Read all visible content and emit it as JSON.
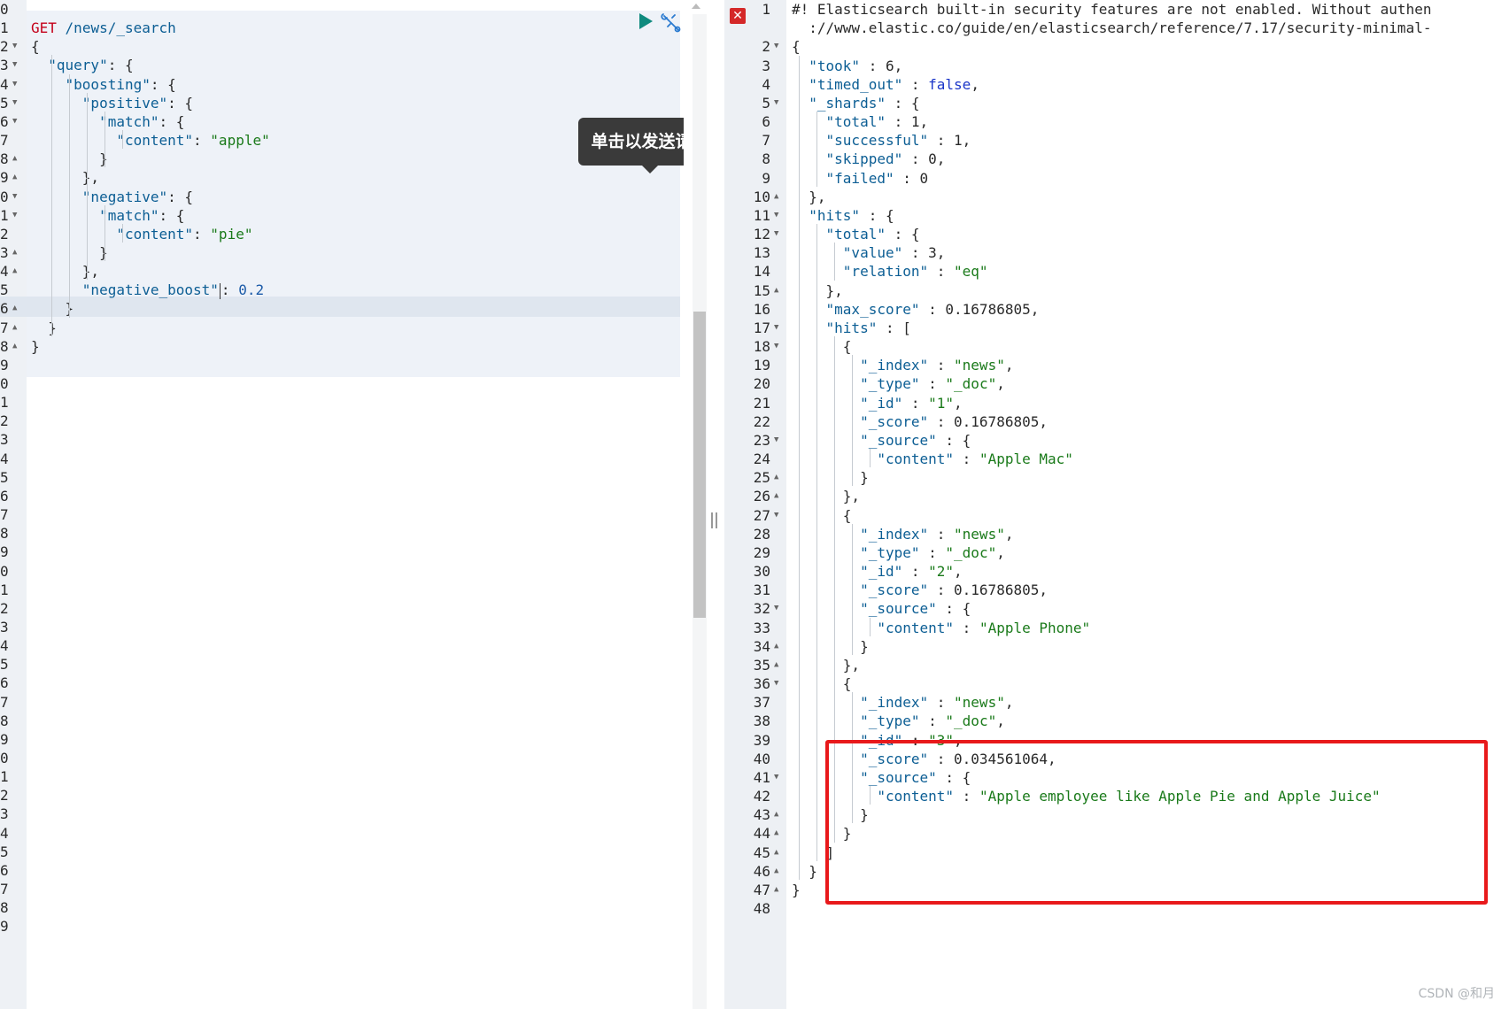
{
  "request": {
    "lines": [
      {
        "n": "0",
        "f": "",
        "t": ""
      },
      {
        "n": "1",
        "f": "",
        "t": [
          [
            "m",
            "GET"
          ],
          [
            "p",
            " "
          ],
          [
            "k",
            "/news/_search"
          ]
        ]
      },
      {
        "n": "2",
        "f": "d",
        "t": [
          [
            "p",
            "{"
          ]
        ]
      },
      {
        "n": "3",
        "f": "d",
        "t": [
          [
            "p",
            "  "
          ],
          [
            "k",
            "\"query\""
          ],
          [
            "p",
            ": {"
          ]
        ]
      },
      {
        "n": "4",
        "f": "d",
        "t": [
          [
            "p",
            "    "
          ],
          [
            "k",
            "\"boosting\""
          ],
          [
            "p",
            ": {"
          ]
        ]
      },
      {
        "n": "5",
        "f": "d",
        "t": [
          [
            "p",
            "      "
          ],
          [
            "k",
            "\"positive\""
          ],
          [
            "p",
            ": {"
          ]
        ]
      },
      {
        "n": "6",
        "f": "d",
        "t": [
          [
            "p",
            "        "
          ],
          [
            "k",
            "\"match\""
          ],
          [
            "p",
            ": {"
          ]
        ]
      },
      {
        "n": "7",
        "f": "",
        "t": [
          [
            "p",
            "          "
          ],
          [
            "k",
            "\"content\""
          ],
          [
            "p",
            ": "
          ],
          [
            "s",
            "\"apple\""
          ]
        ]
      },
      {
        "n": "8",
        "f": "u",
        "t": [
          [
            "p",
            "        }"
          ]
        ]
      },
      {
        "n": "9",
        "f": "u",
        "t": [
          [
            "p",
            "      },"
          ]
        ]
      },
      {
        "n": "0",
        "f": "d",
        "t": [
          [
            "p",
            "      "
          ],
          [
            "k",
            "\"negative\""
          ],
          [
            "p",
            ": {"
          ]
        ]
      },
      {
        "n": "1",
        "f": "d",
        "t": [
          [
            "p",
            "        "
          ],
          [
            "k",
            "\"match\""
          ],
          [
            "p",
            ": {"
          ]
        ]
      },
      {
        "n": "2",
        "f": "",
        "t": [
          [
            "p",
            "          "
          ],
          [
            "k",
            "\"content\""
          ],
          [
            "p",
            ": "
          ],
          [
            "s",
            "\"pie\""
          ]
        ]
      },
      {
        "n": "3",
        "f": "u",
        "t": [
          [
            "p",
            "        }"
          ]
        ]
      },
      {
        "n": "4",
        "f": "u",
        "t": [
          [
            "p",
            "      },"
          ]
        ]
      },
      {
        "n": "5",
        "f": "",
        "t": [
          [
            "p",
            "      "
          ],
          [
            "k",
            "\"negative_boost\""
          ],
          [
            "c",
            ""
          ],
          [
            "p",
            ": "
          ],
          [
            "n",
            "0.2"
          ]
        ]
      },
      {
        "n": "6",
        "f": "u",
        "t": [
          [
            "p",
            "    }"
          ]
        ]
      },
      {
        "n": "7",
        "f": "u",
        "t": [
          [
            "p",
            "  }"
          ]
        ]
      },
      {
        "n": "8",
        "f": "u",
        "t": [
          [
            "p",
            "}"
          ]
        ]
      },
      {
        "n": "9"
      },
      {
        "n": "0"
      },
      {
        "n": "1"
      },
      {
        "n": "2"
      },
      {
        "n": "3"
      },
      {
        "n": "4"
      },
      {
        "n": "5"
      },
      {
        "n": "6"
      },
      {
        "n": "7"
      },
      {
        "n": "8"
      },
      {
        "n": "9"
      },
      {
        "n": "0"
      },
      {
        "n": "1"
      },
      {
        "n": "2"
      },
      {
        "n": "3"
      },
      {
        "n": "4"
      },
      {
        "n": "5"
      },
      {
        "n": "6"
      },
      {
        "n": "7"
      },
      {
        "n": "8"
      },
      {
        "n": "9"
      },
      {
        "n": "0"
      },
      {
        "n": "1"
      },
      {
        "n": "2"
      },
      {
        "n": "3"
      },
      {
        "n": "4"
      },
      {
        "n": "5"
      },
      {
        "n": "6"
      },
      {
        "n": "7"
      },
      {
        "n": "8"
      },
      {
        "n": "9"
      }
    ]
  },
  "tooltip": {
    "label": "单击以发送请求"
  },
  "icons": {
    "run": "play-icon",
    "settings": "wrench-icon",
    "error": "error-x-icon"
  },
  "colors": {
    "highlight": "#e8191b",
    "key": "#0c5e94",
    "string": "#1a7a1a",
    "method": "#c4001a"
  },
  "response": {
    "lines": [
      {
        "n": "1",
        "f": "",
        "t": [
          [
            "p",
            "#! Elasticsearch built-in security features are not enabled. Without authen"
          ]
        ]
      },
      {
        "n": "",
        "f": "",
        "t": [
          [
            "p",
            "  ://www.elastic.co/guide/en/elasticsearch/reference/7.17/security-minimal-"
          ]
        ]
      },
      {
        "n": "2",
        "f": "d",
        "t": [
          [
            "p",
            "{"
          ]
        ]
      },
      {
        "n": "3",
        "f": "",
        "t": [
          [
            "p",
            "  "
          ],
          [
            "k",
            "\"took\""
          ],
          [
            "p",
            " : 6,"
          ]
        ]
      },
      {
        "n": "4",
        "f": "",
        "t": [
          [
            "p",
            "  "
          ],
          [
            "k",
            "\"timed_out\""
          ],
          [
            "p",
            " : "
          ],
          [
            "b",
            "false"
          ],
          [
            "p",
            ","
          ]
        ]
      },
      {
        "n": "5",
        "f": "d",
        "t": [
          [
            "p",
            "  "
          ],
          [
            "k",
            "\"_shards\""
          ],
          [
            "p",
            " : {"
          ]
        ]
      },
      {
        "n": "6",
        "f": "",
        "t": [
          [
            "p",
            "    "
          ],
          [
            "k",
            "\"total\""
          ],
          [
            "p",
            " : 1,"
          ]
        ]
      },
      {
        "n": "7",
        "f": "",
        "t": [
          [
            "p",
            "    "
          ],
          [
            "k",
            "\"successful\""
          ],
          [
            "p",
            " : 1,"
          ]
        ]
      },
      {
        "n": "8",
        "f": "",
        "t": [
          [
            "p",
            "    "
          ],
          [
            "k",
            "\"skipped\""
          ],
          [
            "p",
            " : 0,"
          ]
        ]
      },
      {
        "n": "9",
        "f": "",
        "t": [
          [
            "p",
            "    "
          ],
          [
            "k",
            "\"failed\""
          ],
          [
            "p",
            " : 0"
          ]
        ]
      },
      {
        "n": "10",
        "f": "u",
        "t": [
          [
            "p",
            "  },"
          ]
        ]
      },
      {
        "n": "11",
        "f": "d",
        "t": [
          [
            "p",
            "  "
          ],
          [
            "k",
            "\"hits\""
          ],
          [
            "p",
            " : {"
          ]
        ]
      },
      {
        "n": "12",
        "f": "d",
        "t": [
          [
            "p",
            "    "
          ],
          [
            "k",
            "\"total\""
          ],
          [
            "p",
            " : {"
          ]
        ]
      },
      {
        "n": "13",
        "f": "",
        "t": [
          [
            "p",
            "      "
          ],
          [
            "k",
            "\"value\""
          ],
          [
            "p",
            " : 3,"
          ]
        ]
      },
      {
        "n": "14",
        "f": "",
        "t": [
          [
            "p",
            "      "
          ],
          [
            "k",
            "\"relation\""
          ],
          [
            "p",
            " : "
          ],
          [
            "s",
            "\"eq\""
          ]
        ]
      },
      {
        "n": "15",
        "f": "u",
        "t": [
          [
            "p",
            "    },"
          ]
        ]
      },
      {
        "n": "16",
        "f": "",
        "t": [
          [
            "p",
            "    "
          ],
          [
            "k",
            "\"max_score\""
          ],
          [
            "p",
            " : 0.16786805,"
          ]
        ]
      },
      {
        "n": "17",
        "f": "d",
        "t": [
          [
            "p",
            "    "
          ],
          [
            "k",
            "\"hits\""
          ],
          [
            "p",
            " : ["
          ]
        ]
      },
      {
        "n": "18",
        "f": "d",
        "t": [
          [
            "p",
            "      {"
          ]
        ]
      },
      {
        "n": "19",
        "f": "",
        "t": [
          [
            "p",
            "        "
          ],
          [
            "k",
            "\"_index\""
          ],
          [
            "p",
            " : "
          ],
          [
            "s",
            "\"news\""
          ],
          [
            "p",
            ","
          ]
        ]
      },
      {
        "n": "20",
        "f": "",
        "t": [
          [
            "p",
            "        "
          ],
          [
            "k",
            "\"_type\""
          ],
          [
            "p",
            " : "
          ],
          [
            "s",
            "\"_doc\""
          ],
          [
            "p",
            ","
          ]
        ]
      },
      {
        "n": "21",
        "f": "",
        "t": [
          [
            "p",
            "        "
          ],
          [
            "k",
            "\"_id\""
          ],
          [
            "p",
            " : "
          ],
          [
            "s",
            "\"1\""
          ],
          [
            "p",
            ","
          ]
        ]
      },
      {
        "n": "22",
        "f": "",
        "t": [
          [
            "p",
            "        "
          ],
          [
            "k",
            "\"_score\""
          ],
          [
            "p",
            " : 0.16786805,"
          ]
        ]
      },
      {
        "n": "23",
        "f": "d",
        "t": [
          [
            "p",
            "        "
          ],
          [
            "k",
            "\"_source\""
          ],
          [
            "p",
            " : {"
          ]
        ]
      },
      {
        "n": "24",
        "f": "",
        "t": [
          [
            "p",
            "          "
          ],
          [
            "k",
            "\"content\""
          ],
          [
            "p",
            " : "
          ],
          [
            "s",
            "\"Apple Mac\""
          ]
        ]
      },
      {
        "n": "25",
        "f": "u",
        "t": [
          [
            "p",
            "        }"
          ]
        ]
      },
      {
        "n": "26",
        "f": "u",
        "t": [
          [
            "p",
            "      },"
          ]
        ]
      },
      {
        "n": "27",
        "f": "d",
        "t": [
          [
            "p",
            "      {"
          ]
        ]
      },
      {
        "n": "28",
        "f": "",
        "t": [
          [
            "p",
            "        "
          ],
          [
            "k",
            "\"_index\""
          ],
          [
            "p",
            " : "
          ],
          [
            "s",
            "\"news\""
          ],
          [
            "p",
            ","
          ]
        ]
      },
      {
        "n": "29",
        "f": "",
        "t": [
          [
            "p",
            "        "
          ],
          [
            "k",
            "\"_type\""
          ],
          [
            "p",
            " : "
          ],
          [
            "s",
            "\"_doc\""
          ],
          [
            "p",
            ","
          ]
        ]
      },
      {
        "n": "30",
        "f": "",
        "t": [
          [
            "p",
            "        "
          ],
          [
            "k",
            "\"_id\""
          ],
          [
            "p",
            " : "
          ],
          [
            "s",
            "\"2\""
          ],
          [
            "p",
            ","
          ]
        ]
      },
      {
        "n": "31",
        "f": "",
        "t": [
          [
            "p",
            "        "
          ],
          [
            "k",
            "\"_score\""
          ],
          [
            "p",
            " : 0.16786805,"
          ]
        ]
      },
      {
        "n": "32",
        "f": "d",
        "t": [
          [
            "p",
            "        "
          ],
          [
            "k",
            "\"_source\""
          ],
          [
            "p",
            " : {"
          ]
        ]
      },
      {
        "n": "33",
        "f": "",
        "t": [
          [
            "p",
            "          "
          ],
          [
            "k",
            "\"content\""
          ],
          [
            "p",
            " : "
          ],
          [
            "s",
            "\"Apple Phone\""
          ]
        ]
      },
      {
        "n": "34",
        "f": "u",
        "t": [
          [
            "p",
            "        }"
          ]
        ]
      },
      {
        "n": "35",
        "f": "u",
        "t": [
          [
            "p",
            "      },"
          ]
        ]
      },
      {
        "n": "36",
        "f": "d",
        "t": [
          [
            "p",
            "      {"
          ]
        ]
      },
      {
        "n": "37",
        "f": "",
        "t": [
          [
            "p",
            "        "
          ],
          [
            "k",
            "\"_index\""
          ],
          [
            "p",
            " : "
          ],
          [
            "s",
            "\"news\""
          ],
          [
            "p",
            ","
          ]
        ]
      },
      {
        "n": "38",
        "f": "",
        "t": [
          [
            "p",
            "        "
          ],
          [
            "k",
            "\"_type\""
          ],
          [
            "p",
            " : "
          ],
          [
            "s",
            "\"_doc\""
          ],
          [
            "p",
            ","
          ]
        ]
      },
      {
        "n": "39",
        "f": "",
        "t": [
          [
            "p",
            "        "
          ],
          [
            "k",
            "\"_id\""
          ],
          [
            "p",
            " : "
          ],
          [
            "s",
            "\"3\""
          ],
          [
            "p",
            ","
          ]
        ]
      },
      {
        "n": "40",
        "f": "",
        "t": [
          [
            "p",
            "        "
          ],
          [
            "k",
            "\"_score\""
          ],
          [
            "p",
            " : 0.034561064,"
          ]
        ]
      },
      {
        "n": "41",
        "f": "d",
        "t": [
          [
            "p",
            "        "
          ],
          [
            "k",
            "\"_source\""
          ],
          [
            "p",
            " : {"
          ]
        ]
      },
      {
        "n": "42",
        "f": "",
        "t": [
          [
            "p",
            "          "
          ],
          [
            "k",
            "\"content\""
          ],
          [
            "p",
            " : "
          ],
          [
            "s",
            "\"Apple employee like Apple Pie and Apple Juice\""
          ]
        ]
      },
      {
        "n": "43",
        "f": "u",
        "t": [
          [
            "p",
            "        }"
          ]
        ]
      },
      {
        "n": "44",
        "f": "u",
        "t": [
          [
            "p",
            "      }"
          ]
        ]
      },
      {
        "n": "45",
        "f": "u",
        "t": [
          [
            "p",
            "    ]"
          ]
        ]
      },
      {
        "n": "46",
        "f": "u",
        "t": [
          [
            "p",
            "  }"
          ]
        ]
      },
      {
        "n": "47",
        "f": "u",
        "t": [
          [
            "p",
            "}"
          ]
        ]
      },
      {
        "n": "48",
        "f": "",
        "t": []
      }
    ]
  },
  "watermark": "CSDN @和月"
}
